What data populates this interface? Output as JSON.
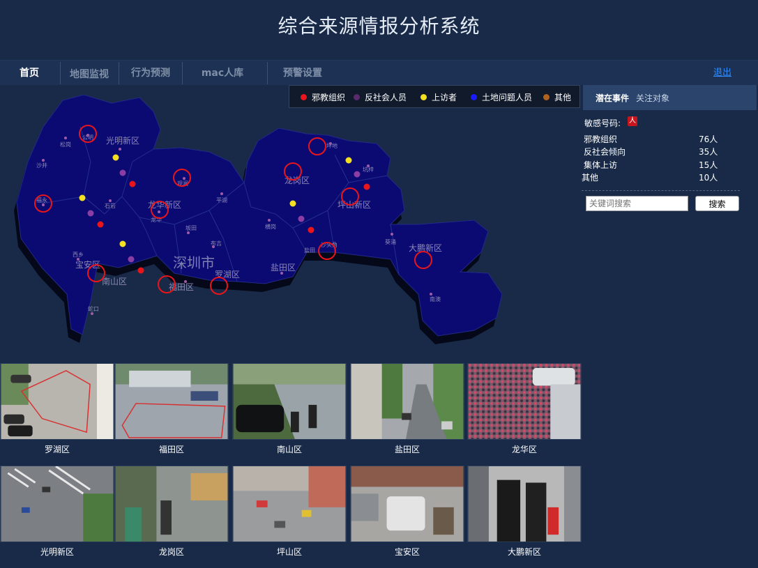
{
  "app_title": "综合来源情报分析系统",
  "nav": {
    "items": [
      {
        "label": "首页",
        "active": true
      },
      {
        "label": "地图监视",
        "active": false
      },
      {
        "label": "行为预测",
        "active": false
      },
      {
        "label": "mac人库",
        "active": false
      },
      {
        "label": "预警设置",
        "active": false
      }
    ],
    "logout_label": "退出"
  },
  "legend": [
    {
      "label": "邪教组织",
      "color": "#e8151b"
    },
    {
      "label": "反社会人员",
      "color": "#5b2a6d"
    },
    {
      "label": "上访者",
      "color": "#f2e021"
    },
    {
      "label": "土地问题人员",
      "color": "#1a1aff"
    },
    {
      "label": "其他",
      "color": "#b0621c"
    }
  ],
  "map": {
    "city_label": "深圳市",
    "districts": [
      "光明新区",
      "龙岗区",
      "龙华新区",
      "坪山新区",
      "大鹏新区",
      "宝安区",
      "南山区",
      "福田区",
      "罗湖区",
      "盐田区"
    ],
    "places": [
      "松岗",
      "公明",
      "沙井",
      "福永",
      "石岩",
      "观澜",
      "龙华",
      "平湖",
      "坂田",
      "横岗",
      "坪地",
      "坑梓",
      "布吉",
      "西乡",
      "蛇口",
      "盐田",
      "沙头角",
      "葵涌",
      "南澳"
    ]
  },
  "side": {
    "tab_active": "潜在事件",
    "tab_inactive": "关注对象",
    "sensitive_label": "敏感号码:",
    "sensitive_icon": "人",
    "stats": [
      {
        "name": "邪教组织",
        "value": "76人"
      },
      {
        "name": "反社会倾向",
        "value": "35人"
      },
      {
        "name": "集体上访",
        "value": "15人"
      },
      {
        "name": "其他",
        "value": "10人"
      }
    ],
    "search_placeholder": "关键词搜索",
    "search_button": "搜索"
  },
  "cameras": [
    {
      "label": "罗湖区"
    },
    {
      "label": "福田区"
    },
    {
      "label": "南山区"
    },
    {
      "label": "盐田区"
    },
    {
      "label": "龙华区"
    },
    {
      "label": "光明新区"
    },
    {
      "label": "龙岗区"
    },
    {
      "label": "坪山区"
    },
    {
      "label": "宝安区"
    },
    {
      "label": "大鹏新区"
    }
  ]
}
